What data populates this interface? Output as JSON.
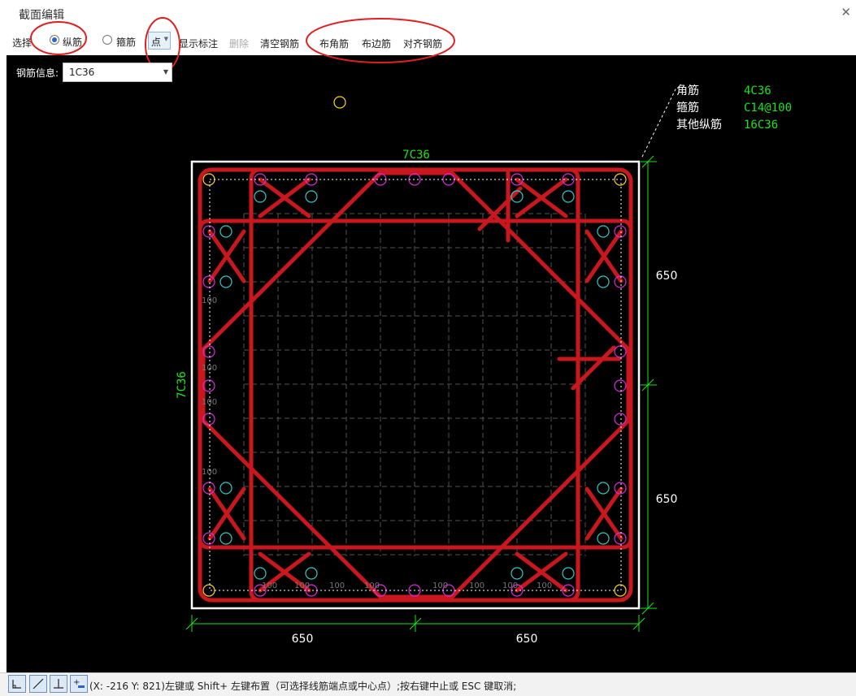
{
  "window": {
    "title": "截面编辑"
  },
  "toolbar": {
    "select_label": "选择",
    "radio_longitudinal": "纵筋",
    "radio_stirrup": "箍筋",
    "mode_value": "点",
    "show_label": "显示标注",
    "delete_label": "删除",
    "clear_label": "清空钢筋",
    "corner_label": "布角筋",
    "side_label": "布边筋",
    "align_label": "对齐钢筋"
  },
  "rebar_info": {
    "label": "钢筋信息:",
    "value": "1C36"
  },
  "legend": [
    {
      "name": "角筋",
      "value": "4C36"
    },
    {
      "name": "箍筋",
      "value": "C14@100"
    },
    {
      "name": "其他纵筋",
      "value": "16C36"
    }
  ],
  "section": {
    "top_label": "7C36",
    "left_label": "7C36",
    "dim_bottom": [
      "650",
      "650"
    ],
    "dim_right": [
      "650",
      "650"
    ],
    "spacing_label": "100"
  },
  "colors": {
    "stirrup": "#c8181e",
    "dim": "#19e619",
    "corner_bar": "#ffd21e",
    "edge_bar": "#dc28dc",
    "inner_bar": "#32c8c8"
  },
  "statusbar": {
    "tools": [
      "corner-tool-icon",
      "line-tool-icon",
      "perpendicular-tool-icon",
      "add-point-icon"
    ],
    "message": "(X: -216 Y: 821)左键或 Shift+ 左键布置（可选择线筋端点或中心点）;按右键中止或 ESC 键取消;"
  }
}
